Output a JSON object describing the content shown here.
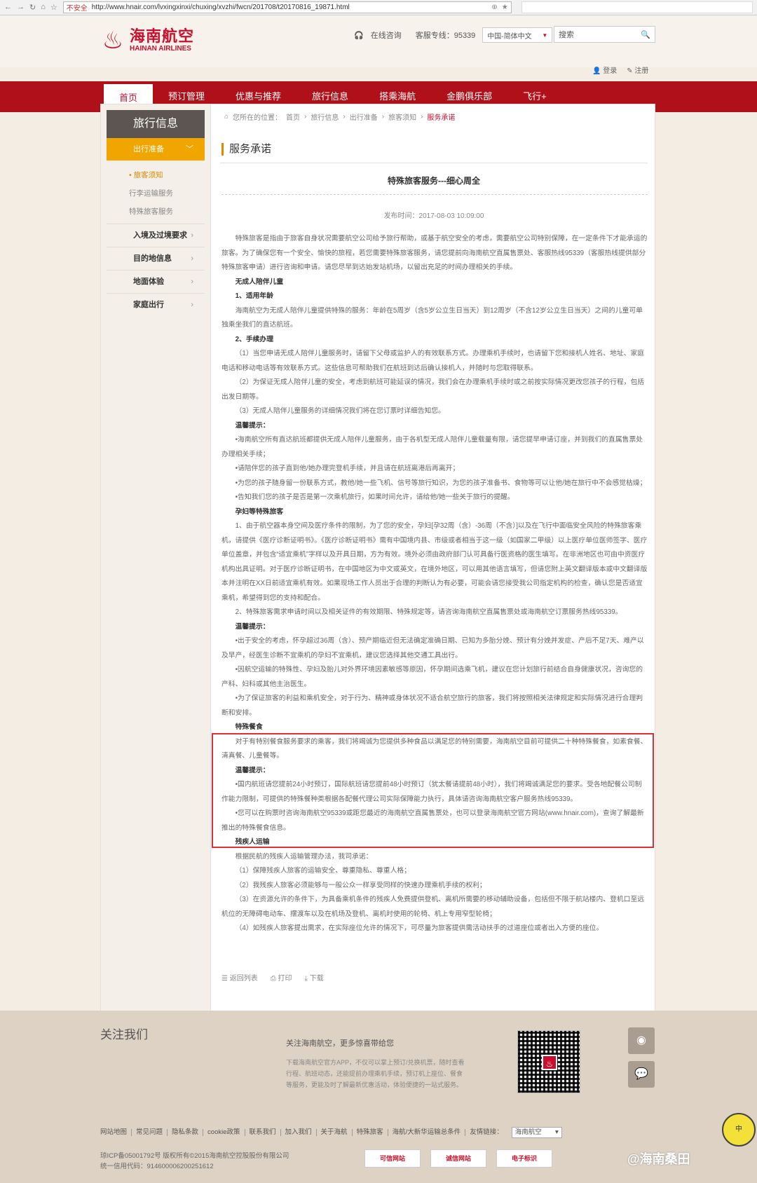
{
  "browser": {
    "insecure": "不安全",
    "url": "http://www.hnair.com/lvxingxinxi/chuxing/xvzhi/fwcn/201708/t20170816_19871.html"
  },
  "brand": {
    "cn": "海南航空",
    "en": "HAINAN AIRLINES"
  },
  "header": {
    "online": "在线咨询",
    "hotline": "客服专线：95339",
    "lang": "中国-简体中文",
    "search_placeholder": "搜索",
    "login": "登录",
    "register": "注册"
  },
  "nav": [
    "首页",
    "预订管理",
    "优惠与推荐",
    "旅行信息",
    "搭乘海航",
    "金鹏俱乐部",
    "飞行+"
  ],
  "sidebar": {
    "title": "旅行信息",
    "active": "出行准备",
    "sub": [
      "旅客须知",
      "行李运输服务",
      "特殊旅客服务"
    ],
    "items": [
      "入境及过境要求",
      "目的地信息",
      "地面体验",
      "家庭出行"
    ]
  },
  "breadcrumb": {
    "prefix": "您所在的位置：",
    "items": [
      "首页",
      "旅行信息",
      "出行准备",
      "旅客须知"
    ],
    "current": "服务承诺"
  },
  "page": {
    "title": "服务承诺",
    "article_title": "特殊旅客服务---细心周全",
    "publish": "发布时间：2017-08-03 10:09:00"
  },
  "paragraphs": [
    {
      "h": false,
      "t": "特殊旅客是指由于旅客自身状况需要航空公司给予旅行帮助，或基于航空安全的考虑，需要航空公司特别保障，在一定条件下才能承运的旅客。为了确保您有一个安全、愉快的旅程，若您需要特殊旅客服务，请您提前向海南航空直属售票处、客服热线95339（客服热线提供部分特殊旅客申请）进行咨询和申请。请您尽早到达始发站机场，以留出充足的时间办理相关的手续。"
    },
    {
      "h": true,
      "t": "无成人陪伴儿童"
    },
    {
      "h": true,
      "t": "1、适用年龄"
    },
    {
      "h": false,
      "t": "海南航空为无成人陪伴儿童提供特殊的服务：年龄在5周岁（含5岁公立生日当天）到12周岁（不含12岁公立生日当天）之间的儿童可单独乘坐我们的直达航班。"
    },
    {
      "h": true,
      "t": "2、手续办理"
    },
    {
      "h": false,
      "t": "（1）当您申请无成人陪伴儿童服务时，请留下父母或监护人的有效联系方式。办理乘机手续时，也请留下您和接机人姓名、地址、家庭电话和移动电话等有效联系方式。这些信息可帮助我们在航班到达后确认接机人，并随时与您取得联系。"
    },
    {
      "h": false,
      "t": "（2）为保证无成人陪伴儿童的安全，考虑到航班可能延误的情况，我们会在办理乘机手续时或之前按实际情况更改您孩子的行程，包括出发日期等。"
    },
    {
      "h": false,
      "t": "（3）无成人陪伴儿童服务的详细情况我们将在您订票时详细告知您。"
    },
    {
      "h": true,
      "t": "温馨提示："
    },
    {
      "h": false,
      "t": "•海南航空所有直达航班都提供无成人陪伴儿童服务，由于各机型无成人陪伴儿童载量有限，请您提早申请订座，并到我们的直属售票处办理相关手续；"
    },
    {
      "h": false,
      "t": "•请陪伴您的孩子直到他/她办理完登机手续，并且请在航班离港后再离开；"
    },
    {
      "h": false,
      "t": "•为您的孩子随身留一份联系方式，教他/她一些飞机、信号等旅行知识，为您的孩子准备书、食物等可以让他/她在旅行中不会感觉枯燥；"
    },
    {
      "h": false,
      "t": "•告知我们您的孩子是否是第一次乘机旅行，如果时间允许，请给他/她一些关于旅行的提醒。"
    },
    {
      "h": true,
      "t": "孕妇等特殊旅客"
    },
    {
      "h": false,
      "t": "1、由于航空器本身空间及医疗条件的限制，为了您的安全，孕妇[孕32周（含）-36周（不含）]以及在飞行中面临安全风险的特殊旅客乘机，请提供《医疗诊断证明书》。《医疗诊断证明书》需有中国境内县、市级或者相当于这一级（如国家二甲级）以上医疗单位医师签字、医疗单位盖章，并包含“适宜乘机”字样以及开具日期，方为有效。境外必须由政府部门认可具备行医资格的医生填写。在非洲地区也可由中资医疗机构出具证明。对于医疗诊断证明书，在中国地区为中文或英文，在境外地区，可以用其他语言填写，但请您附上英文翻译版本或中文翻译版本并注明在XX日前适宜乘机有效。如果现场工作人员出于合理的判断认为有必要，可能会请您接受我公司指定机构的检查，确认您是否适宜乘机，希望得到您的支持和配合。"
    },
    {
      "h": false,
      "t": "2、特殊旅客需求申请时间以及相关证件的有效期限、特殊规定等，请咨询海南航空直属售票处或海南航空订票服务热线95339。"
    },
    {
      "h": true,
      "t": "温馨提示："
    },
    {
      "h": false,
      "t": "•出于安全的考虑，怀孕超过36周（含）、预产期临近但无法确定准确日期、已知为多胎分娩、预计有分娩并发症、产后不足7天、难产以及早产，经医生诊断不宜乘机的孕妇不宜乘机，建议您选择其他交通工具出行。"
    },
    {
      "h": false,
      "t": "•因航空运输的特殊性、孕妇及胎儿对外界环境因素敏感等原因，怀孕期间选乘飞机，建议在您计划旅行前结合自身健康状况，咨询您的产科、妇科或其他主治医生。"
    },
    {
      "h": false,
      "t": "•为了保证旅客的利益和乘机安全，对于行为、精神或身体状况不适合航空旅行的旅客，我们将按照相关法律规定和实际情况进行合理判断和安排。"
    },
    {
      "h": true,
      "t": "特殊餐食"
    },
    {
      "h": false,
      "t": "对于有特别餐食服务要求的乘客，我们将竭诚为您提供多种食品以满足您的特别需要，海南航空目前可提供二十种特殊餐食，如素食餐、清真餐、儿童餐等。"
    },
    {
      "h": true,
      "t": "温馨提示："
    },
    {
      "h": false,
      "t": "•国内航班请您提前24小时预订，国际航班请您提前48小时预订（犹太餐请提前48小时），我们将竭诚满足您的要求。受各地配餐公司制作能力限制，可提供的特殊餐种类根据各配餐代理公司实际保障能力执行，具体请咨询海南航空客户服务热线95339。"
    },
    {
      "h": false,
      "t": "•您可以在购票时咨询海南航空95339或距您最近的海南航空直属售票处，也可以登录海南航空官方网站(www.hnair.com)，查询了解最新推出的特殊餐食信息。"
    },
    {
      "h": true,
      "t": "残疾人运输"
    },
    {
      "h": false,
      "t": "根据民航的残疾人运输管理办法，我司承诺："
    },
    {
      "h": false,
      "t": "（1）保障残疾人旅客的运输安全、尊重隐私、尊重人格；"
    },
    {
      "h": false,
      "t": "（2）我残疾人旅客必须能够与一般公众一样享受同样的快速办理乘机手续的权利；"
    },
    {
      "h": false,
      "t": "（3）在资源允许的条件下，为具备乘机条件的残疾人免费提供登机、离机所需要的移动辅助设备，包括但不限于航站楼内、登机口至远机位的无障碍电动车、摆渡车以及在机场及登机、离机时使用的轮椅、机上专用窄型轮椅；"
    },
    {
      "h": false,
      "t": "（4）如残疾人旅客提出需求，在实际座位允许的情况下，可尽量为旅客提供需活动扶手的过道座位或者出入方便的座位。"
    }
  ],
  "article_foot": {
    "back": "返回列表",
    "print": "打印",
    "download": "下载"
  },
  "footer": {
    "follow": "关注我们",
    "desc_title": "关注海南航空，更多惊喜带给您",
    "desc": "下载海南航空官方APP，不仅可以掌上预订/兑换机票，随时查看行程、航班动态，还能提前办理乘机手续，预订机上座位、餐食等服务，更能及时了解最新优惠活动，体验便捷的一站式服务。",
    "links": [
      "网站地图",
      "常见问题",
      "隐私条款",
      "cookie政策",
      "联系我们",
      "加入我们",
      "关于海航",
      "特殊旅客",
      "海航/大新华运输总条件",
      "友情链接："
    ],
    "friend_select": "海南航空",
    "icp": "琼ICP备05001792号 版权所有©2015海南航空控股股份有限公司",
    "credit": "统一信用代码：914600006200251612",
    "badges": [
      "可信网站",
      "诚信网站",
      "电子标识"
    ]
  },
  "watermark": "@海南桑田"
}
